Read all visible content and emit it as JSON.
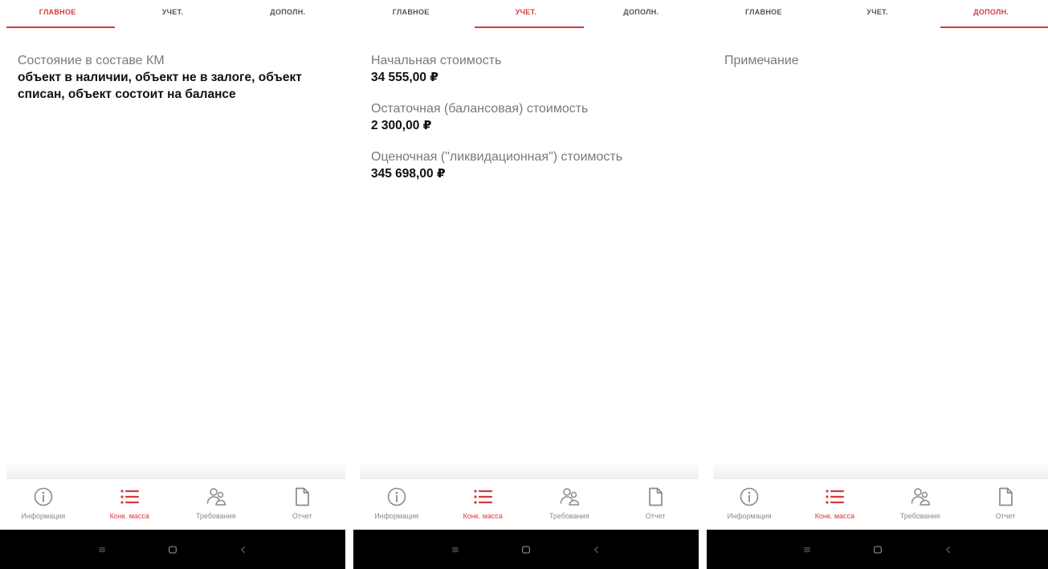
{
  "colors": {
    "accent": "#d9393b",
    "label": "#7a7a7a",
    "value": "#111111",
    "sysbar": "#000000"
  },
  "tabs": [
    "ГЛАВНОЕ",
    "УЧЕТ.",
    "ДОПОЛН."
  ],
  "nav": [
    {
      "label": "Информация",
      "icon": "info-icon"
    },
    {
      "label": "Конк. масса",
      "icon": "list-icon"
    },
    {
      "label": "Требования",
      "icon": "users-icon"
    },
    {
      "label": "Отчет",
      "icon": "document-icon"
    }
  ],
  "system_nav": [
    "menu-icon",
    "home-icon",
    "back-icon"
  ],
  "screens": [
    {
      "active_tab": 0,
      "active_nav": 1,
      "fields": [
        {
          "label": "Состояние в составе КМ",
          "value": "объект в наличии, объект не в залоге, объект списан, объект состоит на балансе"
        }
      ]
    },
    {
      "active_tab": 1,
      "active_nav": 1,
      "fields": [
        {
          "label": "Начальная стоимость",
          "value": "34 555,00 ₽"
        },
        {
          "label": "Остаточная (балансовая) стоимость",
          "value": "2 300,00 ₽"
        },
        {
          "label": "Оценочная (\"ликвидационная\") стоимость",
          "value": "345 698,00 ₽"
        }
      ]
    },
    {
      "active_tab": 2,
      "active_nav": 1,
      "fields": [
        {
          "label": "Примечание",
          "value": ""
        }
      ]
    }
  ]
}
